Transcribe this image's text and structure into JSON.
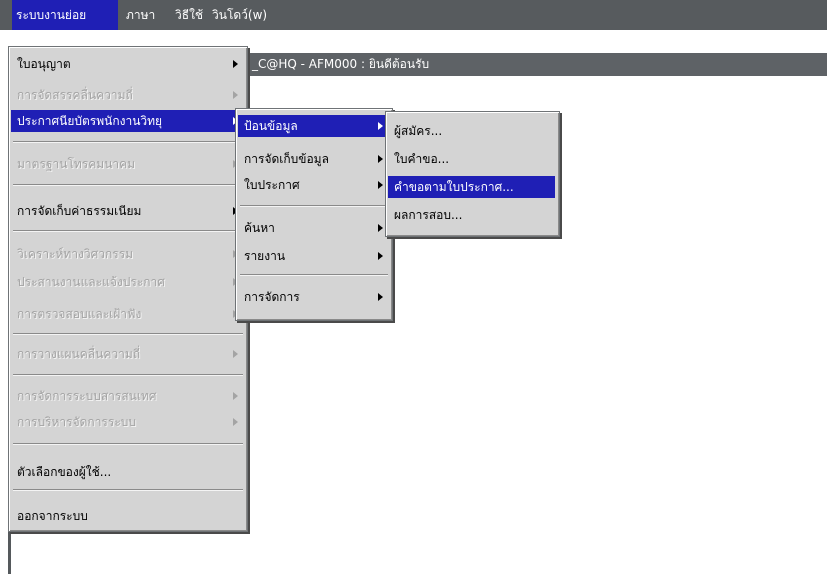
{
  "menubar": {
    "items": [
      {
        "label": "ระบบงานย่อย",
        "active": true
      },
      {
        "label": "ภาษา",
        "active": false
      },
      {
        "label": "วิธีใช้",
        "active": false
      },
      {
        "label": "วินโดว์(w)",
        "active": false
      }
    ]
  },
  "window": {
    "title": "_C@HQ - AFM000 : ยินดีต้อนรับ"
  },
  "main_menu": {
    "items": [
      {
        "label": "ใบอนุญาต",
        "enabled": true,
        "submenu": true
      },
      {
        "label": "การจัดสรรคลื่นความถี่",
        "enabled": false,
        "submenu": true
      },
      {
        "label": "ประกาศนียบัตรพนักงานวิทยุ",
        "enabled": true,
        "submenu": true,
        "highlighted": true
      },
      {
        "label": "มาตรฐานโทรคมนาคม",
        "enabled": false,
        "submenu": true
      },
      {
        "label": "การจัดเก็บค่าธรรมเนียม",
        "enabled": true,
        "submenu": true
      },
      {
        "label": "วิเคราะห์ทางวิศวกรรม",
        "enabled": false,
        "submenu": true
      },
      {
        "label": "ประสานงานและแจ้งประกาศ",
        "enabled": false,
        "submenu": true
      },
      {
        "label": "การตรวจสอบและเฝ้าฟัง",
        "enabled": false,
        "submenu": true
      },
      {
        "label": "การวางแผนคลื่นความถี่",
        "enabled": false,
        "submenu": true
      },
      {
        "label": "การจัดการระบบสารสนเทศ",
        "enabled": false,
        "submenu": true
      },
      {
        "label": "การบริหารจัดการระบบ",
        "enabled": false,
        "submenu": true
      },
      {
        "label": "ตัวเลือกของผู้ใช้...",
        "enabled": true,
        "submenu": false
      },
      {
        "label": "ออกจากระบบ",
        "enabled": true,
        "submenu": false
      }
    ]
  },
  "sub_menu": {
    "items": [
      {
        "label": "ป้อนข้อมูล",
        "highlighted": true
      },
      {
        "label": "การจัดเก็บข้อมูล"
      },
      {
        "label": "ใบประกาศ"
      },
      {
        "label": "ค้นหา"
      },
      {
        "label": "รายงาน"
      },
      {
        "label": "การจัดการ"
      }
    ]
  },
  "third_menu": {
    "items": [
      {
        "label": "ผู้สมัคร..."
      },
      {
        "label": "ใบคำขอ..."
      },
      {
        "label": "คำขอตามใบประกาศ...",
        "highlighted": true
      },
      {
        "label": "ผลการสอบ..."
      }
    ]
  },
  "colors": {
    "highlight": "#1f1fb5",
    "menu_bg": "#d4d4d4",
    "bar_bg": "#575b5e",
    "disabled_text": "#a4a4a4"
  }
}
